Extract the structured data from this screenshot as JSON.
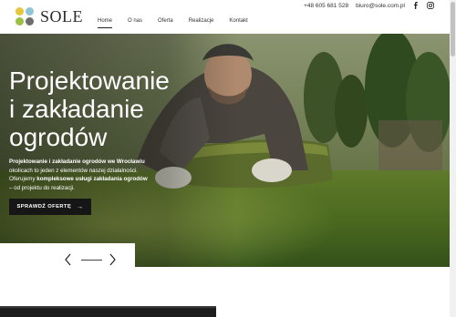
{
  "header": {
    "brand": "SOLE",
    "phone": "+48 605 681 528",
    "email": "biuro@sole.com.pl",
    "social": [
      "facebook-icon",
      "instagram-icon"
    ]
  },
  "nav": {
    "items": [
      {
        "label": "Home",
        "active": true
      },
      {
        "label": "O nas"
      },
      {
        "label": "Oferta"
      },
      {
        "label": "Realizacje"
      },
      {
        "label": "Kontakt"
      }
    ]
  },
  "hero": {
    "title_lines": [
      "Projektowanie",
      "i zakładanie",
      "ogrodów"
    ],
    "desc": {
      "line1": "Projektowanie i zakładanie ogrodów we Wrocławiu",
      "line2": "okolicach to jeden z elementów naszej działalności.",
      "line3_pre": "Oferujemy ",
      "line3_bold": "kompleksowe usługi zakładania ogrodów",
      "line4": "– od projektu do realizacji."
    },
    "cta_label": "SPRAWDŹ OFERTĘ"
  },
  "colors": {
    "accent_dark": "#161616",
    "logo_yellow": "#e6c63a",
    "logo_blue": "#8fc5d6",
    "logo_green": "#9cc043",
    "logo_gray": "#6d6f6c"
  }
}
